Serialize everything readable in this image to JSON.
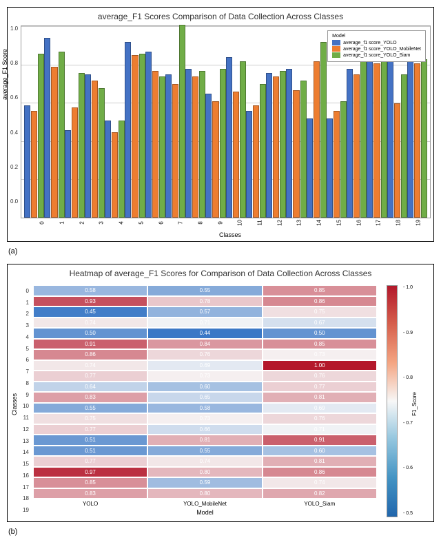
{
  "chart_data": [
    {
      "type": "bar",
      "title": "average_F1 Scores Comparison of Data Collection Across Classes",
      "xlabel": "Classes",
      "ylabel": "average_F1 Score",
      "ylim": [
        0,
        1.0
      ],
      "categories": [
        "0",
        "1",
        "2",
        "3",
        "4",
        "5",
        "6",
        "7",
        "8",
        "9",
        "10",
        "11",
        "12",
        "13",
        "14",
        "15",
        "16",
        "17",
        "18",
        "19"
      ],
      "series": [
        {
          "name": "average_f1 score_YOLO",
          "values": [
            0.58,
            0.93,
            0.45,
            0.74,
            0.5,
            0.91,
            0.86,
            0.74,
            0.77,
            0.64,
            0.83,
            0.55,
            0.75,
            0.77,
            0.51,
            0.51,
            0.77,
            0.97,
            0.85,
            0.83
          ]
        },
        {
          "name": "average_f1 score_YOLO_MobileNet",
          "values": [
            0.55,
            0.78,
            0.57,
            0.71,
            0.44,
            0.84,
            0.76,
            0.69,
            0.73,
            0.6,
            0.65,
            0.58,
            0.73,
            0.66,
            0.81,
            0.55,
            0.74,
            0.8,
            0.59,
            0.8
          ]
        },
        {
          "name": "average_f1 score_YOLO_Siam",
          "values": [
            0.85,
            0.86,
            0.75,
            0.67,
            0.5,
            0.85,
            0.73,
            1.0,
            0.76,
            0.77,
            0.81,
            0.69,
            0.76,
            0.71,
            0.91,
            0.6,
            0.81,
            0.86,
            0.74,
            0.82
          ]
        }
      ],
      "legend": {
        "title": "Model",
        "position": "top-right"
      }
    },
    {
      "type": "heatmap",
      "title": "Heatmap of average_F1 Scores for Comparison of Data Collection Across Classes",
      "xlabel": "Model",
      "ylabel": "Classes",
      "x": [
        "YOLO",
        "YOLO_MobileNet",
        "YOLO_Siam"
      ],
      "y": [
        "0",
        "1",
        "2",
        "3",
        "4",
        "5",
        "6",
        "7",
        "8",
        "9",
        "10",
        "11",
        "12",
        "13",
        "14",
        "15",
        "16",
        "17",
        "18",
        "19"
      ],
      "z": [
        [
          0.58,
          0.55,
          0.85
        ],
        [
          0.93,
          0.78,
          0.86
        ],
        [
          0.45,
          0.57,
          0.75
        ],
        [
          0.74,
          0.71,
          0.67
        ],
        [
          0.5,
          0.44,
          0.5
        ],
        [
          0.91,
          0.84,
          0.85
        ],
        [
          0.86,
          0.76,
          0.73
        ],
        [
          0.74,
          0.69,
          1.0
        ],
        [
          0.77,
          0.73,
          0.76
        ],
        [
          0.64,
          0.6,
          0.77
        ],
        [
          0.83,
          0.65,
          0.81
        ],
        [
          0.55,
          0.58,
          0.69
        ],
        [
          0.75,
          0.73,
          0.76
        ],
        [
          0.77,
          0.66,
          0.71
        ],
        [
          0.51,
          0.81,
          0.91
        ],
        [
          0.51,
          0.55,
          0.6
        ],
        [
          0.77,
          0.74,
          0.81
        ],
        [
          0.97,
          0.8,
          0.86
        ],
        [
          0.85,
          0.59,
          0.74
        ],
        [
          0.83,
          0.8,
          0.82
        ]
      ],
      "colorbar": {
        "label": "F1_Score",
        "vmin": 0.5,
        "vmax": 1.0,
        "ticks": [
          "1.0",
          "0.9",
          "0.8",
          "0.7",
          "0.6",
          "0.5"
        ]
      }
    }
  ],
  "captions": {
    "a": "(a)",
    "b": "(b)"
  },
  "colors": {
    "yolo": "#4472c4",
    "mobilenet": "#ed7d31",
    "siam": "#70ad47"
  },
  "yticks": [
    "1.0",
    "0.8",
    "0.6",
    "0.4",
    "0.2",
    "0.0"
  ]
}
